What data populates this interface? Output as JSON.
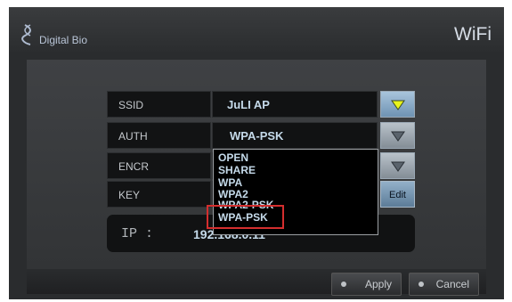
{
  "header": {
    "brand": "Digital Bio",
    "title": "WiFi"
  },
  "form": {
    "ssid": {
      "label": "SSID",
      "value": "JuLI AP"
    },
    "auth": {
      "label": "AUTH",
      "value": "WPA-PSK"
    },
    "encr": {
      "label": "ENCR"
    },
    "key": {
      "label": "KEY",
      "edit_label": "Edit"
    }
  },
  "auth_dropdown": {
    "options": [
      "OPEN",
      "SHARE",
      "WPA",
      "WPA2",
      "WPA2-PSK",
      "WPA-PSK"
    ],
    "highlighted": "WPA-PSK"
  },
  "ip": {
    "label": "IP  :",
    "value": "192.168.0.11"
  },
  "footer": {
    "apply_label": "Apply",
    "cancel_label": "Cancel"
  },
  "colors": {
    "accent_active": "#6f93b3",
    "triangle_active": "#e8f41a",
    "value_text": "#c5daea",
    "highlight": "#d42e2e"
  }
}
